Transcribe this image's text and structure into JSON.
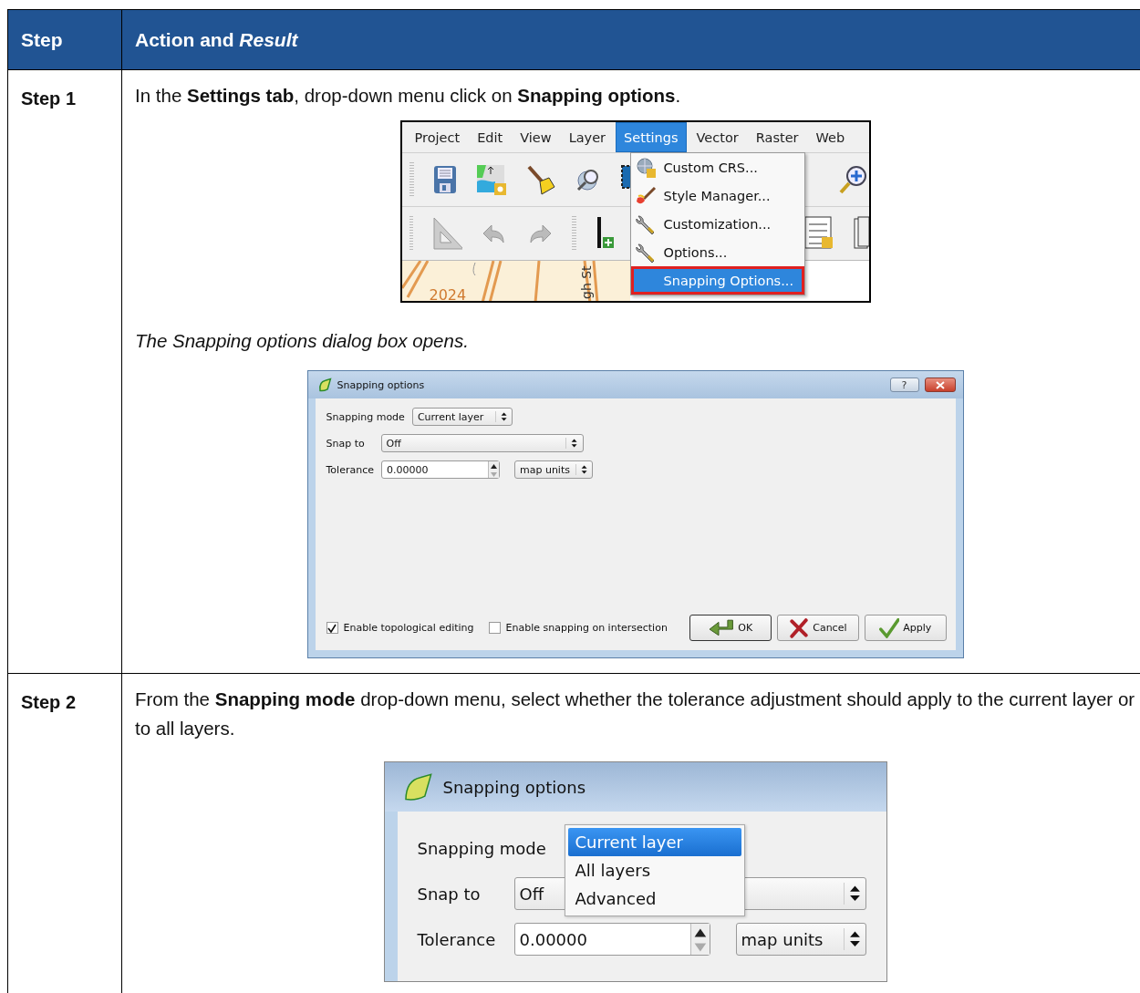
{
  "table": {
    "columns": [
      "Step",
      "Action and *Result*"
    ],
    "rows": [
      {
        "step": "Step 1",
        "blocks": [
          {
            "kind": "text",
            "text": "In the **Settings tab**, drop-down menu click on **Snapping options**."
          },
          {
            "kind": "menu_screenshot",
            "menubar": [
              {
                "label": "Project",
                "selected": false
              },
              {
                "label": "Edit",
                "selected": false
              },
              {
                "label": "View",
                "selected": false
              },
              {
                "label": "Layer",
                "selected": false
              },
              {
                "label": "Settings",
                "selected": true
              },
              {
                "label": "Vector",
                "selected": false
              },
              {
                "label": "Raster",
                "selected": false
              },
              {
                "label": "Web",
                "selected": false
              }
            ],
            "menu_items": [
              {
                "label": "Custom CRS...",
                "selected": false,
                "highlighted": false
              },
              {
                "label": "Style Manager...",
                "selected": false,
                "highlighted": false
              },
              {
                "label": "Customization...",
                "selected": false,
                "highlighted": false
              },
              {
                "label": "Options...",
                "selected": false,
                "highlighted": false
              },
              {
                "label": "Snapping Options...",
                "selected": true,
                "highlighted": true
              }
            ],
            "map_labels": [
              "2024",
              "gh St"
            ]
          },
          {
            "kind": "result",
            "text": "The Snapping options dialog box opens."
          },
          {
            "kind": "dialog",
            "title": "Snapping options",
            "help": "?",
            "fields": [
              {
                "kind": "combo",
                "label": "Snapping mode",
                "value": "Current layer"
              },
              {
                "kind": "combo",
                "label": "Snap to",
                "value": "Off"
              },
              {
                "kind": "spin",
                "label": "Tolerance",
                "value": "0.00000",
                "unit": "map units"
              }
            ],
            "checkboxes": [
              {
                "label": "Enable topological editing",
                "checked": true
              },
              {
                "label": "Enable snapping on intersection",
                "checked": false
              }
            ],
            "buttons": [
              {
                "label": "OK",
                "default": true
              },
              {
                "label": "Cancel",
                "default": false
              },
              {
                "label": "Apply",
                "default": false
              }
            ]
          }
        ]
      },
      {
        "step": "Step 2",
        "blocks": [
          {
            "kind": "text",
            "text": "From the **Snapping mode** drop-down menu, select whether the tolerance adjustment should apply to the current layer or to all layers."
          },
          {
            "kind": "dialog_zoom",
            "title": "Snapping options",
            "fields": [
              {
                "kind": "combo",
                "label": "Snapping mode",
                "options": [
                  {
                    "label": "Current layer",
                    "selected": true
                  },
                  {
                    "label": "All layers",
                    "selected": false
                  },
                  {
                    "label": "Advanced",
                    "selected": false
                  }
                ]
              },
              {
                "kind": "combo",
                "label": "Snap to",
                "value": "Off"
              },
              {
                "kind": "spin",
                "label": "Tolerance",
                "value": "0.00000",
                "unit": "map units"
              }
            ]
          }
        ]
      }
    ]
  }
}
